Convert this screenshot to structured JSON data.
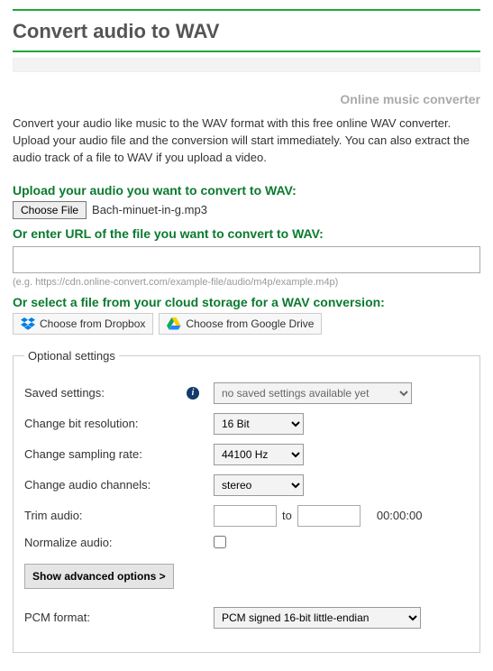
{
  "header": {
    "title": "Convert audio to WAV",
    "subtitle": "Online music converter",
    "intro": "Convert your audio like music to the WAV format with this free online WAV converter. Upload your audio file and the conversion will start immediately. You can also extract the audio track of a file to WAV if you upload a video."
  },
  "upload": {
    "label": "Upload your audio you want to convert to WAV:",
    "choose_button": "Choose File",
    "selected_file": "Bach-minuet-in-g.mp3"
  },
  "url": {
    "label": "Or enter URL of the file you want to convert to WAV:",
    "value": "",
    "hint": "(e.g. https://cdn.online-convert.com/example-file/audio/m4p/example.m4p)"
  },
  "cloud": {
    "label": "Or select a file from your cloud storage for a WAV conversion:",
    "dropbox_label": "Choose from Dropbox",
    "gdrive_label": "Choose from Google Drive"
  },
  "optional": {
    "legend": "Optional settings",
    "saved": {
      "label": "Saved settings:",
      "selected": "no saved settings available yet"
    },
    "bit": {
      "label": "Change bit resolution:",
      "selected": "16 Bit"
    },
    "sampling": {
      "label": "Change sampling rate:",
      "selected": "44100 Hz"
    },
    "channels": {
      "label": "Change audio channels:",
      "selected": "stereo"
    },
    "trim": {
      "label": "Trim audio:",
      "from": "",
      "to_word": "to",
      "to": "",
      "duration": "00:00:00"
    },
    "normalize": {
      "label": "Normalize audio:",
      "checked": false
    },
    "advanced_button": "Show advanced options >",
    "pcm": {
      "label": "PCM format:",
      "selected": "PCM signed 16-bit little-endian"
    }
  }
}
